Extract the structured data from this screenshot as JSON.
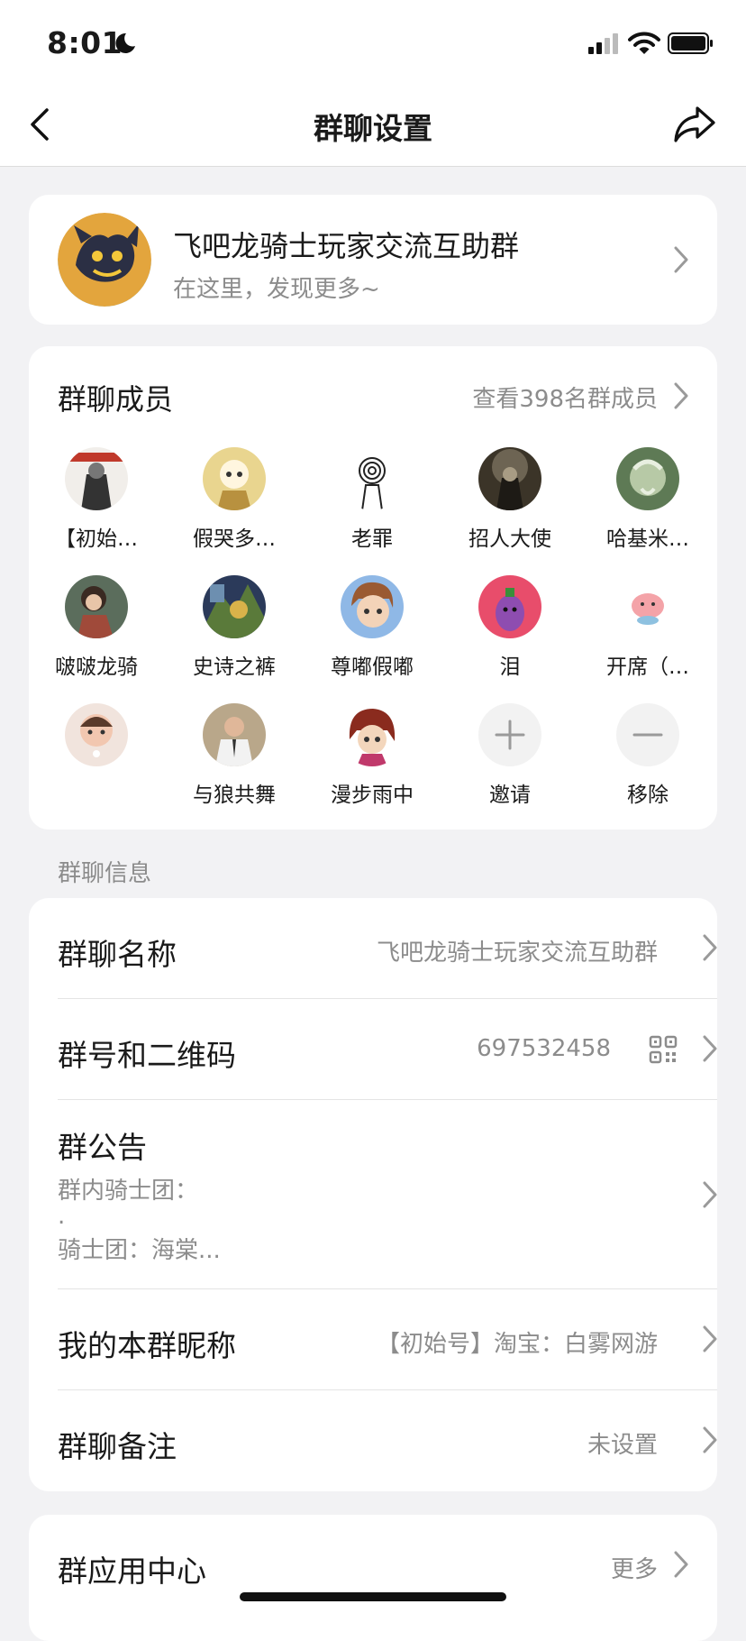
{
  "status_bar": {
    "time": "8:01"
  },
  "header": {
    "title": "群聊设置"
  },
  "group": {
    "name": "飞吧龙骑士玩家交流互助群",
    "subtitle": "在这里，发现更多~"
  },
  "members": {
    "title": "群聊成员",
    "view_all": "查看398名群成员",
    "list": [
      {
        "name": "【初始…"
      },
      {
        "name": "假哭多…"
      },
      {
        "name": "老罪"
      },
      {
        "name": "招人大使"
      },
      {
        "name": "哈基米…"
      },
      {
        "name": "啵啵龙骑"
      },
      {
        "name": "史诗之裤"
      },
      {
        "name": "尊嘟假嘟"
      },
      {
        "name": "泪"
      },
      {
        "name": "开席（…"
      },
      {
        "name": ""
      },
      {
        "name": "与狼共舞"
      },
      {
        "name": "漫步雨中"
      }
    ],
    "invite_label": "邀请",
    "remove_label": "移除"
  },
  "info": {
    "section_title": "群聊信息",
    "name_label": "群聊名称",
    "name_value": "飞吧龙骑士玩家交流互助群",
    "number_label": "群号和二维码",
    "number_value": "697532458",
    "notice_label": "群公告",
    "notice_lines": [
      "群内骑士团：",
      ".",
      "骑士团：海棠..."
    ],
    "nickname_label": "我的本群昵称",
    "nickname_value": "【初始号】淘宝：白雾网游",
    "remark_label": "群聊备注",
    "remark_value": "未设置"
  },
  "apps": {
    "label": "群应用中心",
    "more": "更多"
  },
  "colors": {
    "background": "#f2f2f4",
    "card": "#ffffff",
    "primary_text": "#1a1a1a",
    "secondary_text": "#8c8c8c"
  }
}
